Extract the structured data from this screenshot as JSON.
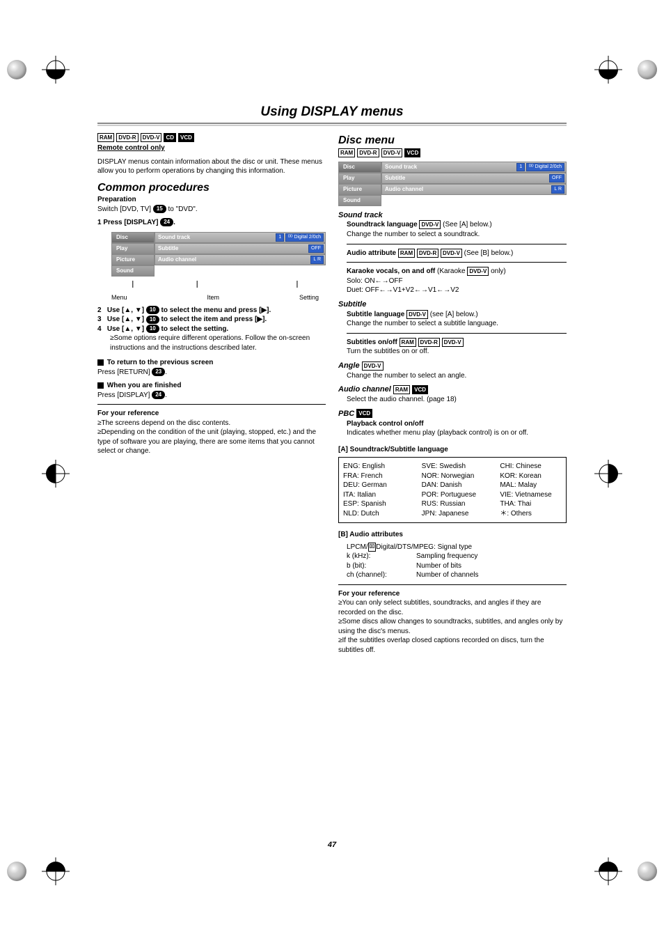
{
  "pageTitle": "Using DISPLAY menus",
  "pageNumber": "47",
  "left": {
    "tags": [
      "RAM",
      "DVD-R",
      "DVD-V",
      "CD",
      "VCD"
    ],
    "remoteOnly": "Remote control only",
    "intro": "DISPLAY menus contain information about the disc or unit. These menus allow you to perform operations by changing this information.",
    "commonHeading": "Common procedures",
    "prepLabel": "Preparation",
    "prepText1": "Switch [DVD, TV] ",
    "prepPill1": "15",
    "prepText2": " to \"DVD\".",
    "step1a": "1   Press [DISPLAY] ",
    "step1Pill": "24",
    "step1b": ".",
    "osd": {
      "menu": [
        "Disc",
        "Play",
        "Picture",
        "Sound"
      ],
      "rows": [
        {
          "label": "Sound track",
          "badges": [
            "1",
            "ᴰᴰ Digital  2/0ch"
          ]
        },
        {
          "label": "Subtitle",
          "badges": [
            "OFF"
          ]
        },
        {
          "label": "Audio channel",
          "badges": [
            "L R"
          ]
        }
      ],
      "captions": [
        "Menu",
        "Item",
        "Setting"
      ]
    },
    "step2": "2   Use [▲, ▼] ⬛10⬛ to select the menu and press [▶].",
    "step3": "3   Use [▲, ▼] ⬛10⬛ to select the item and press [▶].",
    "step4": "4   Use [▲, ▼] ⬛10⬛ to select the setting.",
    "step4note": "≥Some options require different operations. Follow the on-screen instructions and the instructions described later.",
    "retHead": " To return to the previous screen",
    "retText1": "Press [RETURN] ",
    "retPill": "23",
    "retText2": ".",
    "finHead": " When you are finished",
    "finText1": "Press [DISPLAY] ",
    "finPill": "24",
    "finText2": ".",
    "fyr": "For your reference",
    "fyr1": "≥The screens depend on the disc contents.",
    "fyr2": "≥Depending on the condition of the unit (playing, stopped, etc.) and the type of software you are playing, there are some items that you cannot select or change."
  },
  "right": {
    "discMenuHeading": "Disc menu",
    "tags": [
      "RAM",
      "DVD-R",
      "DVD-V",
      "VCD"
    ],
    "osd": {
      "menu": [
        "Disc",
        "Play",
        "Picture",
        "Sound"
      ],
      "rows": [
        {
          "label": "Sound track",
          "badges": [
            "1",
            "ᴰᴰ Digital  2/0ch"
          ]
        },
        {
          "label": "Subtitle",
          "badges": [
            "OFF"
          ]
        },
        {
          "label": "Audio channel",
          "badges": [
            "L R"
          ]
        }
      ]
    },
    "soundTrack": {
      "h": "Sound track",
      "l1": "Soundtrack language ",
      "l1tag": "DVD-V",
      "l1after": " (See [A] below.)",
      "l2": "Change the number to select a soundtrack.",
      "l3": "Audio attribute ",
      "l3tags": [
        "RAM",
        "DVD-R",
        "DVD-V"
      ],
      "l3after": " (See [B] below.)",
      "l4": "Karaoke vocals, on and off",
      "l4after1": " (Karaoke ",
      "l4tag": "DVD-V",
      "l4after2": " only)",
      "l5": "Solo: ON←→OFF",
      "l6": "Duet: OFF←→V1+V2←→V1←→V2"
    },
    "subtitle": {
      "h": "Subtitle",
      "l1": "Subtitle language ",
      "l1tag": "DVD-V",
      "l1after": " (see [A] below.)",
      "l2": "Change the number to select a subtitle language.",
      "l3": "Subtitles on/off ",
      "l3tags": [
        "RAM",
        "DVD-R",
        "DVD-V"
      ],
      "l4": "Turn the subtitles on or off."
    },
    "angle": {
      "h": "Angle ",
      "tag": "DVD-V",
      "l1": "Change the number to select an angle."
    },
    "audioCh": {
      "h": "Audio channel ",
      "tags": [
        "RAM",
        "VCD"
      ],
      "l1": "Select the audio channel. (page 18)"
    },
    "pbc": {
      "h": "PBC ",
      "tag": "VCD",
      "l1": "Playback control on/off",
      "l2": "Indicates whether menu play (playback control) is on or off."
    },
    "secA": "[A] Soundtrack/Subtitle language",
    "langs": {
      "c1": [
        "ENG: English",
        "FRA: French",
        "DEU: German",
        "ITA: Italian",
        "ESP: Spanish",
        "NLD: Dutch"
      ],
      "c2": [
        "SVE: Swedish",
        "NOR: Norwegian",
        "DAN: Danish",
        "POR: Portuguese",
        "RUS: Russian",
        "JPN: Japanese"
      ],
      "c3": [
        "CHI: Chinese",
        "KOR: Korean",
        "MAL: Malay",
        "VIE: Vietnamese",
        "THA: Thai",
        "＊: Others"
      ]
    },
    "secB": "[B] Audio attributes",
    "attrs": {
      "r0a": "LPCM/",
      "r0b": " Digital/DTS/MPEG: Signal type",
      "r1k": "k (kHz):",
      "r1v": "Sampling frequency",
      "r2k": "b (bit):",
      "r2v": "Number of bits",
      "r3k": "ch (channel):",
      "r3v": "Number of channels"
    },
    "fyr": "For your reference",
    "fyr1": "≥You can only select subtitles, soundtracks, and angles if they are recorded on the disc.",
    "fyr2": "≥Some discs allow changes to soundtracks, subtitles, and angles only by using the disc's menus.",
    "fyr3": "≥If the subtitles overlap closed captions recorded on discs, turn the subtitles off."
  }
}
